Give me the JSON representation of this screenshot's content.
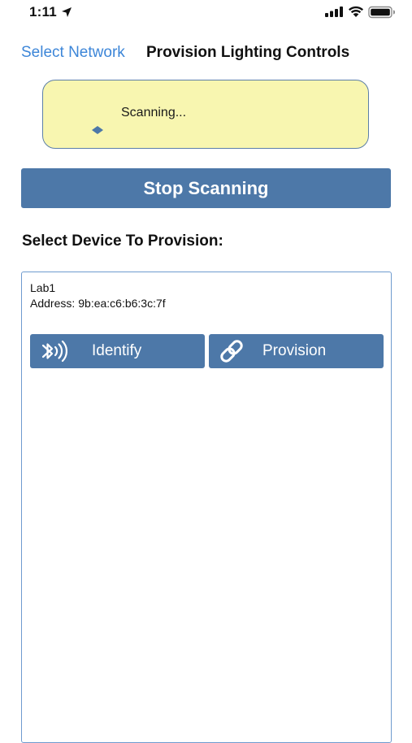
{
  "status_bar": {
    "time": "1:11",
    "icons": [
      "location-arrow-icon",
      "cellular-signal-icon",
      "wifi-icon",
      "battery-icon"
    ]
  },
  "nav": {
    "back_label": "Select Network",
    "title": "Provision Lighting Controls"
  },
  "scan_banner": {
    "text": "Scanning...",
    "spinner_icon": "activity-spinner-icon"
  },
  "stop_button": {
    "label": "Stop Scanning"
  },
  "section": {
    "heading": "Select Device To Provision:"
  },
  "devices": [
    {
      "name": "Lab1",
      "address_label": "Address:",
      "address": "9b:ea:c6:b6:3c:7f",
      "identify_label": "Identify",
      "identify_icon": "bluetooth-signal-icon",
      "provision_label": "Provision",
      "provision_icon": "link-icon"
    }
  ],
  "colors": {
    "accent_link": "#3d86d8",
    "button_blue": "#4d78a8",
    "banner_yellow": "#f8f6b0",
    "list_border": "#6f9bcf"
  }
}
